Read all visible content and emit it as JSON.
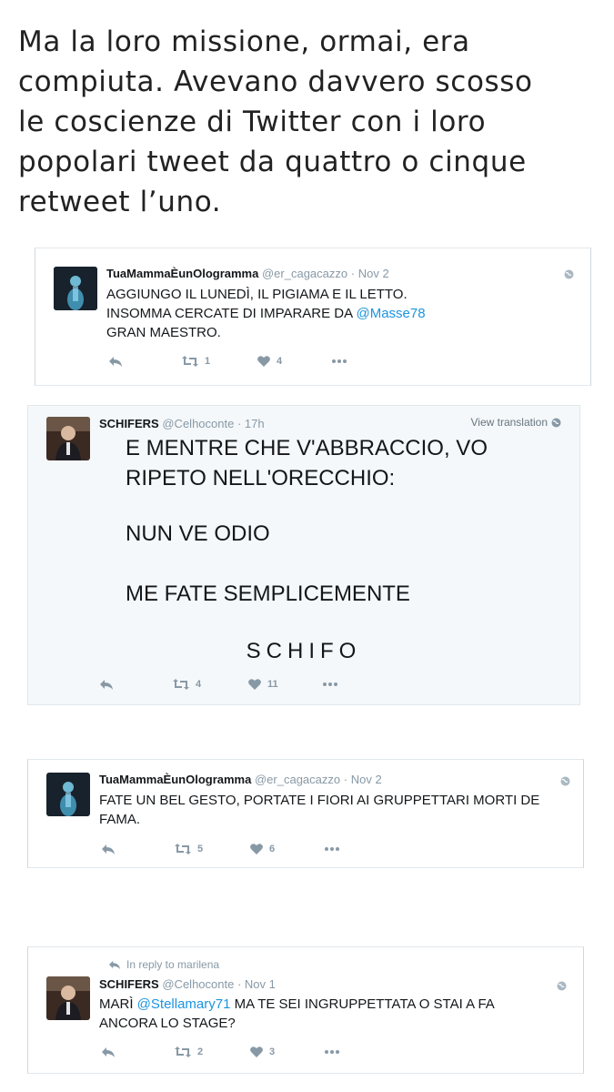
{
  "intro": {
    "lines": [
      "Ma la loro missione, ormai, era",
      "compiuta. Avevano davvero scosso",
      "le coscienze di Twitter con i loro",
      "popolari tweet da quattro o cinque",
      "retweet l’uno."
    ]
  },
  "tweets": [
    {
      "name": "TuaMammaÈunOlogramma",
      "handle": "@er_cagacazzo",
      "sep": "·",
      "time": "Nov 2",
      "text_1": "AGGIUNGO IL LUNEDÌ, IL PIGIAMA E IL LETTO.\nINSOMMA CERCATE DI IMPARARE DA ",
      "mention": "@Masse78",
      "text_2": "\nGRAN MAESTRO.",
      "retweets": "1",
      "likes": "4"
    },
    {
      "name": "SCHIFERS",
      "handle": "@Celhoconte",
      "sep": "·",
      "time": "17h",
      "view_translation": "View translation",
      "lines": [
        "E MENTRE CHE V'ABBRACCIO, VO",
        "RIPETO NELL'ORECCHIO:",
        "NUN VE ODIO",
        "ME FATE SEMPLICEMENTE",
        "SCHIFO"
      ],
      "retweets": "4",
      "likes": "11"
    },
    {
      "name": "TuaMammaÈunOlogramma",
      "handle": "@er_cagacazzo",
      "sep": "·",
      "time": "Nov 2",
      "text": "FATE UN BEL GESTO, PORTATE I FIORI AI GRUPPETTARI MORTI DE\nFAMA.",
      "retweets": "5",
      "likes": "6"
    },
    {
      "reply_context": "In reply to marilena",
      "name": "SCHIFERS",
      "handle": "@Celhoconte",
      "sep": "·",
      "time": "Nov 1",
      "text_1": "MARÌ ",
      "mention": "@Stellamary71",
      "text_2": " MA TE SEI INGRUPPETTATA O STAI A FA\nANCORA LO STAGE?",
      "retweets": "2",
      "likes": "3"
    }
  ],
  "colors": {
    "mention": "#1b95e0",
    "meta": "#8899a6",
    "highlight_bg": "#f5f8fa",
    "border": "#e1e8ed"
  },
  "icons": [
    "reply-icon",
    "retweet-icon",
    "like-icon",
    "more-icon",
    "globe-icon"
  ]
}
